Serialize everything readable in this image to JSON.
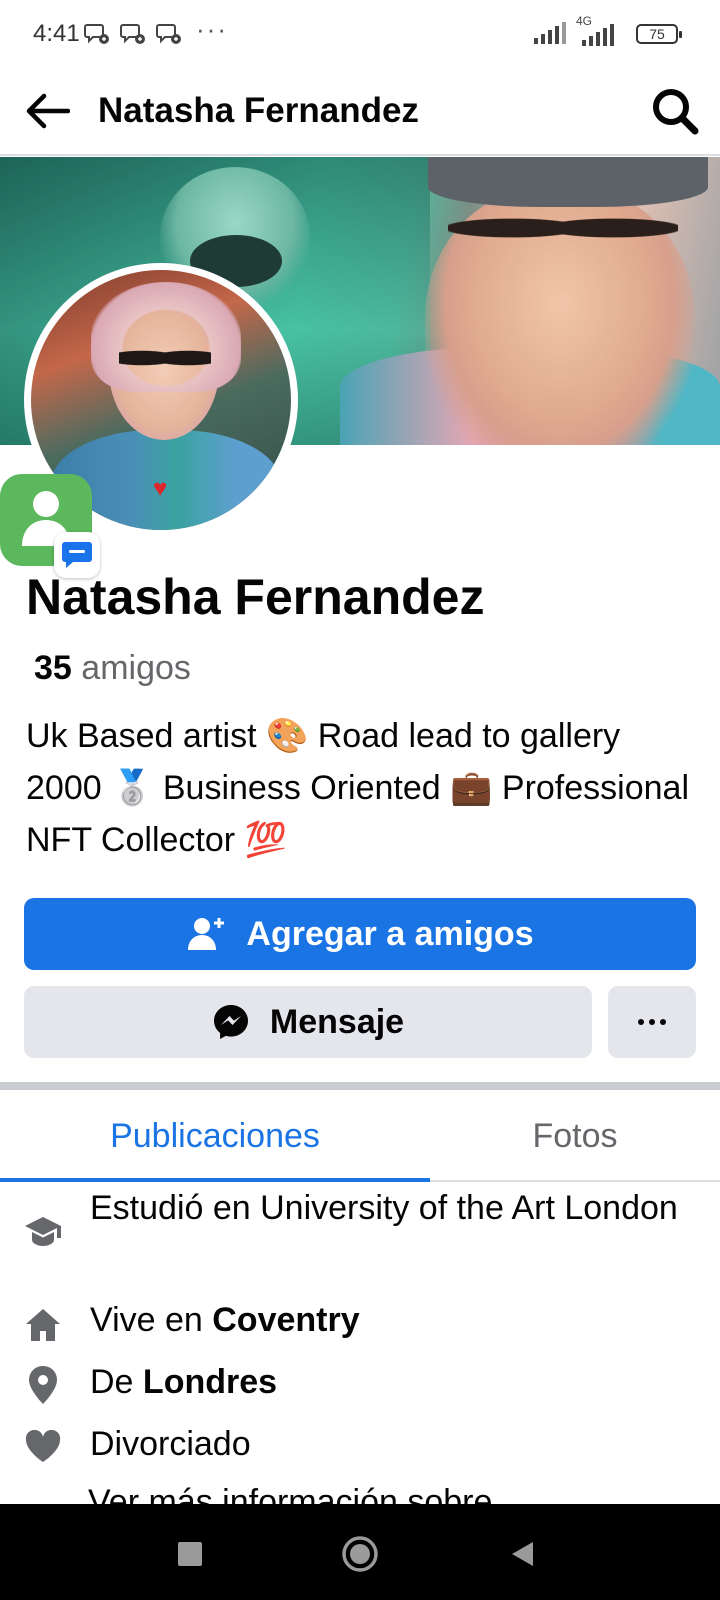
{
  "status_bar": {
    "time": "4:41",
    "more_dots": "···",
    "network": "4G",
    "battery": "75",
    "icons": [
      "messenger-notification-icon",
      "messenger-notification-icon",
      "messenger-notification-icon",
      "signal-icon",
      "signal-4g-icon",
      "battery-icon"
    ]
  },
  "app_bar": {
    "title": "Natasha Fernandez",
    "back_icon": "arrow-left-icon",
    "search_icon": "search-icon"
  },
  "profile": {
    "name": "Natasha Fernandez",
    "friends_count": "35",
    "friends_label": "amigos",
    "bio": "Uk Based artist 🎨 Road lead to gallery 2000 🥈 Business Oriented 💼 Professional NFT Collector 💯"
  },
  "actions": {
    "add_friend": "Agregar a amigos",
    "message": "Mensaje",
    "more": "···"
  },
  "tabs": [
    {
      "label": "Publicaciones",
      "active": true
    },
    {
      "label": "Fotos",
      "active": false
    }
  ],
  "details": {
    "education": "Estudió en University of the Art London",
    "lives_prefix": "Vive en",
    "lives_city": "Coventry",
    "from_prefix": "De",
    "from_city": "Londres",
    "relationship": "Divorciado",
    "see_more": "Ver más información sobre"
  },
  "colors": {
    "accent": "#1b74e4",
    "secondary_button": "#e4e6eb",
    "muted_text": "#65676b"
  }
}
